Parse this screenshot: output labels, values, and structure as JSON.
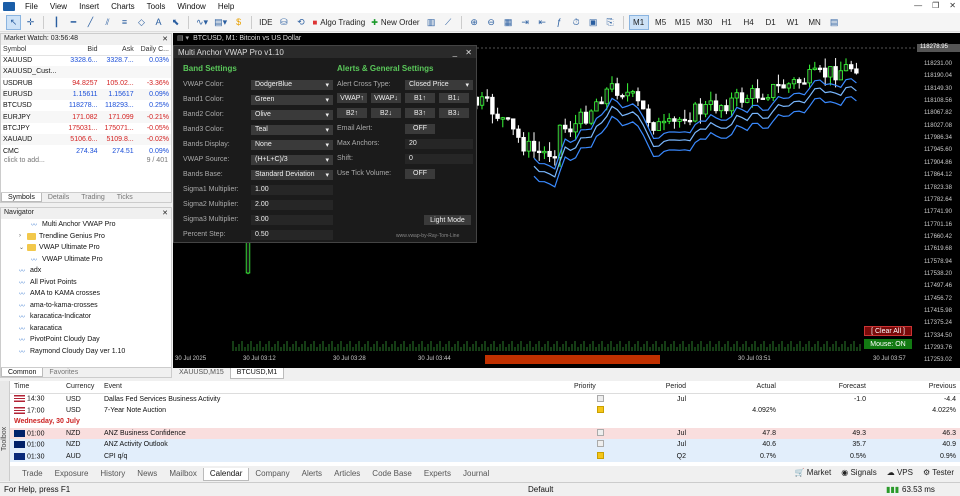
{
  "menu": [
    "File",
    "View",
    "Insert",
    "Charts",
    "Tools",
    "Window",
    "Help"
  ],
  "toolbar": {
    "algo_trading": "Algo Trading",
    "new_order": "New Order",
    "ide": "IDE",
    "timeframes": [
      "M1",
      "M5",
      "M15",
      "M30",
      "H1",
      "H4",
      "D1",
      "W1",
      "MN"
    ],
    "active_timeframe": "M1"
  },
  "market_watch": {
    "title": "Market Watch: 03:56:48",
    "headers": [
      "Symbol",
      "Bid",
      "Ask",
      "Daily C..."
    ],
    "rows": [
      {
        "symbol": "XAUUSD",
        "bid": "3328.6...",
        "ask": "3328.7...",
        "chg": "0.03%",
        "dir": "up"
      },
      {
        "symbol": "XAUUSD_Cust...",
        "bid": "",
        "ask": "",
        "chg": "",
        "dir": ""
      },
      {
        "symbol": "USDRUB",
        "bid": "94.8257",
        "ask": "105.02...",
        "chg": "-3.36%",
        "dir": "dn"
      },
      {
        "symbol": "EURUSD",
        "bid": "1.15611",
        "ask": "1.15617",
        "chg": "0.09%",
        "dir": "up"
      },
      {
        "symbol": "BTCUSD",
        "bid": "118278...",
        "ask": "118293...",
        "chg": "0.25%",
        "dir": "up"
      },
      {
        "symbol": "EURJPY",
        "bid": "171.082",
        "ask": "171.099",
        "chg": "-0.21%",
        "dir": "dn"
      },
      {
        "symbol": "BTCJPY",
        "bid": "175031...",
        "ask": "175071...",
        "chg": "-0.05%",
        "dir": "dn"
      },
      {
        "symbol": "XAUAUD",
        "bid": "5106.6...",
        "ask": "5109.8...",
        "chg": "-0.02%",
        "dir": "dn"
      },
      {
        "symbol": "CMC",
        "bid": "274.34",
        "ask": "274.51",
        "chg": "0.09%",
        "dir": "up"
      }
    ],
    "add_hint": "click to add...",
    "count": "9 / 401",
    "tabs": [
      "Symbols",
      "Details",
      "Trading",
      "Ticks"
    ]
  },
  "navigator": {
    "title": "Navigator",
    "items": [
      {
        "label": "Multi Anchor VWAP Pro",
        "type": "ind",
        "level": 3
      },
      {
        "label": "Trendline Genius Pro",
        "type": "folder",
        "level": 2
      },
      {
        "label": "VWAP Ultimate Pro",
        "type": "folder",
        "level": 2
      },
      {
        "label": "VWAP Ultimate Pro",
        "type": "ind",
        "level": 3
      },
      {
        "label": "adx",
        "type": "ind",
        "level": 2
      },
      {
        "label": "All Pivot Points",
        "type": "ind",
        "level": 2
      },
      {
        "label": "AMA to KAMA crosses",
        "type": "ind",
        "level": 2
      },
      {
        "label": "ama-to-kama-crosses",
        "type": "ind",
        "level": 2
      },
      {
        "label": "karacatica-Indicator",
        "type": "ind",
        "level": 2
      },
      {
        "label": "karacatica",
        "type": "ind",
        "level": 2
      },
      {
        "label": "PivotPoint Cloudy Day",
        "type": "ind",
        "level": 2
      },
      {
        "label": "Raymond Cloudy Day ver 1.10",
        "type": "ind",
        "level": 2
      }
    ],
    "tabs": [
      "Common",
      "Favorites"
    ]
  },
  "chart": {
    "tab_label": "BTCUSD, M1:  Bitcoin vs US Dollar",
    "price_labels": [
      "118231.00",
      "118190.04",
      "118149.30",
      "118108.56",
      "118067.82",
      "118027.08",
      "117986.34",
      "117945.60",
      "117904.86",
      "117864.12",
      "117823.38",
      "117782.64",
      "117741.90",
      "117701.16",
      "117660.42",
      "117619.68",
      "117578.94",
      "117538.20",
      "117497.46",
      "117456.72",
      "117415.98",
      "117375.24",
      "117334.50",
      "117293.76",
      "117253.02"
    ],
    "current_price": "118278.95",
    "time_labels": [
      "30 Jul 2025",
      "30 Jul 03:12",
      "30 Jul 03:28",
      "30 Jul 03:44",
      "30 Jul 03:51",
      "30 Jul 03:57"
    ],
    "clear_all": "[ Clear All ]",
    "mouse_on": "Mouse: ON"
  },
  "chart_tabs": [
    "XAUUSD,M15",
    "BTCUSD,M1"
  ],
  "dialog": {
    "title": "Multi Anchor VWAP Pro v1.10",
    "band_header": "Band Settings",
    "alerts_header": "Alerts & General Settings",
    "left_rows": [
      {
        "label": "VWAP Color:",
        "value": "DodgerBlue",
        "kind": "dd"
      },
      {
        "label": "Band1 Color:",
        "value": "Green",
        "kind": "dd"
      },
      {
        "label": "Band2 Color:",
        "value": "Olive",
        "kind": "dd"
      },
      {
        "label": "Band3 Color:",
        "value": "Teal",
        "kind": "dd"
      },
      {
        "label": "Bands Display:",
        "value": "None",
        "kind": "dd"
      },
      {
        "label": "VWAP Source:",
        "value": "(H+L+C)/3",
        "kind": "dd"
      },
      {
        "label": "Bands Base:",
        "value": "Standard Deviation",
        "kind": "dd"
      },
      {
        "label": "Sigma1 Multiplier:",
        "value": "1.00",
        "kind": "in"
      },
      {
        "label": "Sigma2 Multiplier:",
        "value": "2.00",
        "kind": "in"
      },
      {
        "label": "Sigma3 Multiplier:",
        "value": "3.00",
        "kind": "in"
      },
      {
        "label": "Percent Step:",
        "value": "0.50",
        "kind": "in"
      }
    ],
    "alert_cross_label": "Alert Cross Type:",
    "alert_cross_value": "Closed Price",
    "vwap_buttons": [
      "VWAP↑",
      "VWAP↓",
      "B1↑",
      "B1↓"
    ],
    "band_buttons": [
      "B2↑",
      "B2↓",
      "B3↑",
      "B3↓"
    ],
    "email_label": "Email Alert:",
    "email_value": "OFF",
    "max_anchors_label": "Max Anchors:",
    "max_anchors_value": "20",
    "shift_label": "Shift:",
    "shift_value": "0",
    "tick_label": "Use Tick Volume:",
    "tick_value": "OFF",
    "light_mode": "Light Mode",
    "footer": "www.vwap-by-Ray-Tom-Line"
  },
  "calendar": {
    "headers": [
      "Time",
      "Currency",
      "Event",
      "Priority",
      "Period",
      "Actual",
      "Forecast",
      "Previous"
    ],
    "rows": [
      {
        "time": "14:30",
        "flag": "us",
        "cur": "USD",
        "event": "Dallas Fed Services Business Activity",
        "pri": "",
        "period": "Jul",
        "actual": "",
        "forecast": "-1.0",
        "prev": "-4.4",
        "bg": ""
      },
      {
        "time": "17:00",
        "flag": "us",
        "cur": "USD",
        "event": "7-Year Note Auction",
        "pri": "y",
        "period": "",
        "actual": "4.092%",
        "forecast": "",
        "prev": "4.022%",
        "bg": ""
      },
      {
        "time": "Wednesday, 30 July",
        "flag": "",
        "cur": "",
        "event": "",
        "pri": "",
        "period": "",
        "actual": "",
        "forecast": "",
        "prev": "",
        "bg": "day"
      },
      {
        "time": "01:00",
        "flag": "nz",
        "cur": "NZD",
        "event": "ANZ Business Confidence",
        "pri": "",
        "period": "Jul",
        "actual": "47.8",
        "forecast": "49.3",
        "prev": "46.3",
        "bg": "pink"
      },
      {
        "time": "01:00",
        "flag": "nz",
        "cur": "NZD",
        "event": "ANZ Activity Outlook",
        "pri": "",
        "period": "Jul",
        "actual": "40.6",
        "forecast": "35.7",
        "prev": "40.9",
        "bg": "blue"
      },
      {
        "time": "01:30",
        "flag": "au",
        "cur": "AUD",
        "event": "CPI q/q",
        "pri": "y",
        "period": "Q2",
        "actual": "0.7%",
        "forecast": "0.5%",
        "prev": "0.9%",
        "bg": "blue"
      }
    ]
  },
  "bottom_tabs": [
    "Trade",
    "Exposure",
    "History",
    "News",
    "Mailbox",
    "Calendar",
    "Company",
    "Alerts",
    "Articles",
    "Code Base",
    "Experts",
    "Journal"
  ],
  "bottom_right": [
    "Market",
    "Signals",
    "VPS",
    "Tester"
  ],
  "toolbox_label": "Toolbox",
  "status": {
    "help": "For Help, press F1",
    "profile": "Default",
    "ping": "63.53 ms"
  }
}
